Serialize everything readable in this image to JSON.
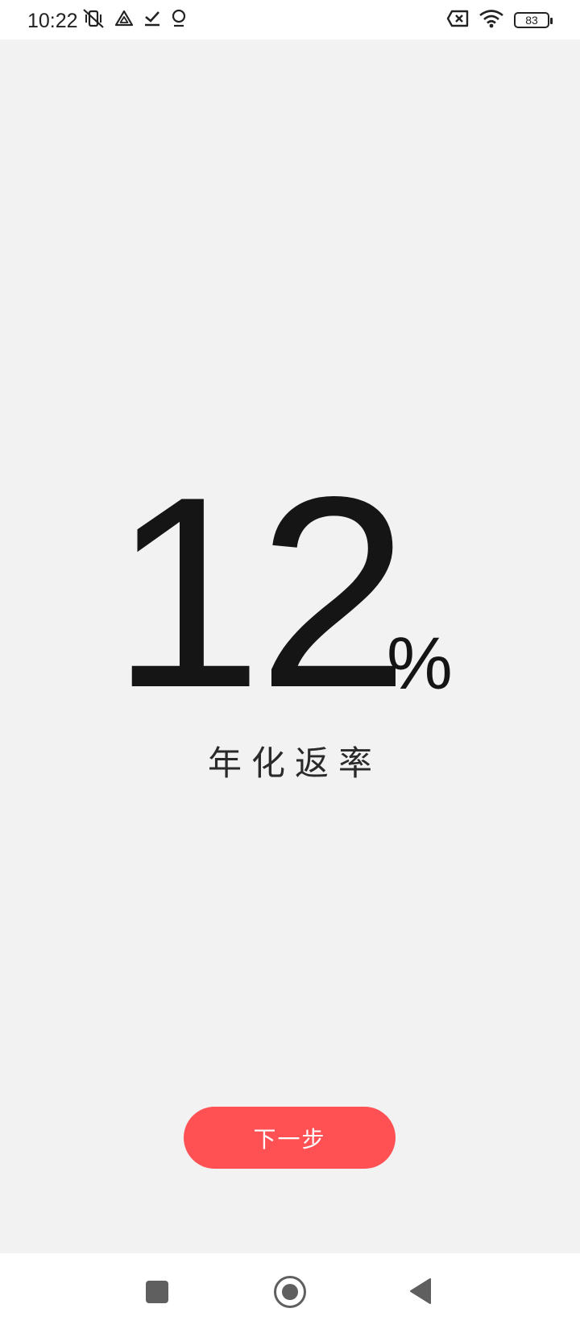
{
  "status_bar": {
    "time": "10:22",
    "battery": "83",
    "left_icons": [
      "vibrate-off-icon",
      "drive-icon",
      "download-done-icon",
      "location-icon"
    ],
    "right_icons": [
      "sim-disabled-icon",
      "wifi-icon",
      "battery-icon"
    ]
  },
  "main": {
    "rate_value": "12",
    "rate_unit": "%",
    "rate_label": "年化返率"
  },
  "actions": {
    "next_label": "下一步"
  },
  "colors": {
    "accent": "#ff5154",
    "background": "#f2f2f2",
    "text": "#151515"
  },
  "nav_bar": {
    "buttons": [
      "recents-button",
      "home-button",
      "back-button"
    ]
  }
}
